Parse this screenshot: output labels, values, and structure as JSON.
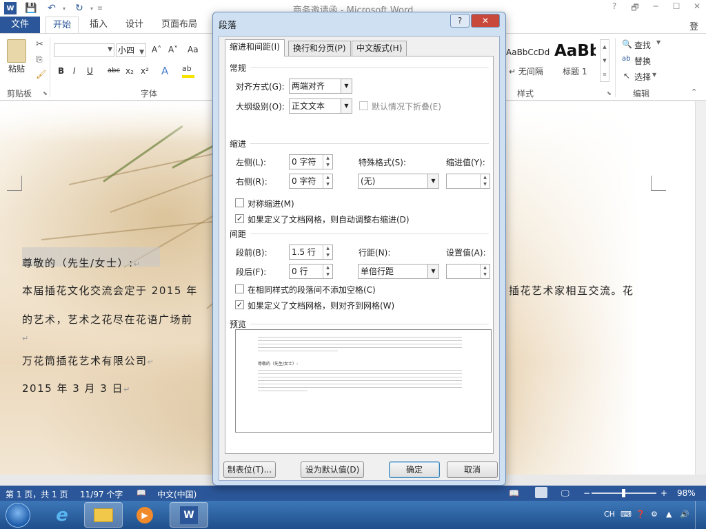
{
  "window": {
    "title": "商务邀请函 - Microsoft Word",
    "login": "登录",
    "help_btn": "?",
    "restore_btn": "🗗",
    "minimize_btn": "─",
    "maximize_btn": "☐",
    "close_btn": "✕"
  },
  "ribbon": {
    "tabs": [
      "文件",
      "开始",
      "插入",
      "设计",
      "页面布局"
    ],
    "clipboard": {
      "paste": "粘贴",
      "label": "剪贴板"
    },
    "font": {
      "name_value": "",
      "size_value": "小四",
      "grow": "A˄",
      "shrink": "A˅",
      "case": "Aa",
      "label": "字体",
      "bold": "B",
      "italic": "I",
      "underline": "U",
      "strike": "abc",
      "sub": "x₂",
      "sup": "x²"
    },
    "styles": {
      "style1_preview": "AaBbCcDd",
      "style1_name": "↵ 无间隔",
      "style2_preview": "AaBb",
      "style2_name": "标题 1",
      "label": "样式"
    },
    "editing": {
      "find": "查找",
      "replace": "替换",
      "select": "选择",
      "label": "编辑"
    }
  },
  "document": {
    "lines": [
      "尊敬的（先生/女士）:",
      "本届插花文化交流会定于 2015 年",
      "插花艺术家相互交流。花",
      "的艺术，艺术之花尽在花语广场前",
      "万花筒插花艺术有限公司",
      "2015 年 3 月 3 日"
    ],
    "para_mark": "↵"
  },
  "dialog": {
    "title": "段落",
    "help": "?",
    "close": "✕",
    "tabs": [
      "缩进和间距(I)",
      "换行和分页(P)",
      "中文版式(H)"
    ],
    "general": {
      "section": "常规",
      "align_label": "对齐方式(G):",
      "align_value": "两端对齐",
      "outline_label": "大纲级别(O):",
      "outline_value": "正文文本",
      "collapse_label": "默认情况下折叠(E)"
    },
    "indent": {
      "section": "缩进",
      "left_label": "左侧(L):",
      "left_value": "0 字符",
      "right_label": "右侧(R):",
      "right_value": "0 字符",
      "special_label": "特殊格式(S):",
      "special_value": "(无)",
      "by_label": "缩进值(Y):",
      "by_value": "",
      "mirror_label": "对称缩进(M)",
      "auto_adjust_label": "如果定义了文档网格，则自动调整右缩进(D)"
    },
    "spacing": {
      "section": "间距",
      "before_label": "段前(B):",
      "before_value": "1.5 行",
      "after_label": "段后(F):",
      "after_value": "0 行",
      "line_label": "行距(N):",
      "line_value": "单倍行距",
      "at_label": "设置值(A):",
      "at_value": "",
      "no_space_label": "在相同样式的段落间不添加空格(C)",
      "snap_grid_label": "如果定义了文档网格，则对齐到网格(W)"
    },
    "preview": {
      "section": "预览",
      "sample": "尊敬的（先生/女士）:"
    },
    "buttons": {
      "tabs": "制表位(T)...",
      "default": "设为默认值(D)",
      "ok": "确定",
      "cancel": "取消"
    },
    "checks": {
      "collapse": false,
      "mirror": false,
      "auto_adjust": true,
      "no_space": false,
      "snap_grid": true
    }
  },
  "statusbar": {
    "page": "第 1 页，共 1 页",
    "words": "11/97 个字",
    "lang": "中文(中国)",
    "zoom": "98%"
  },
  "taskbar": {
    "ime": "CH",
    "apps": [
      "start-orb",
      "internet-explorer",
      "file-explorer",
      "media-player",
      "word"
    ]
  }
}
